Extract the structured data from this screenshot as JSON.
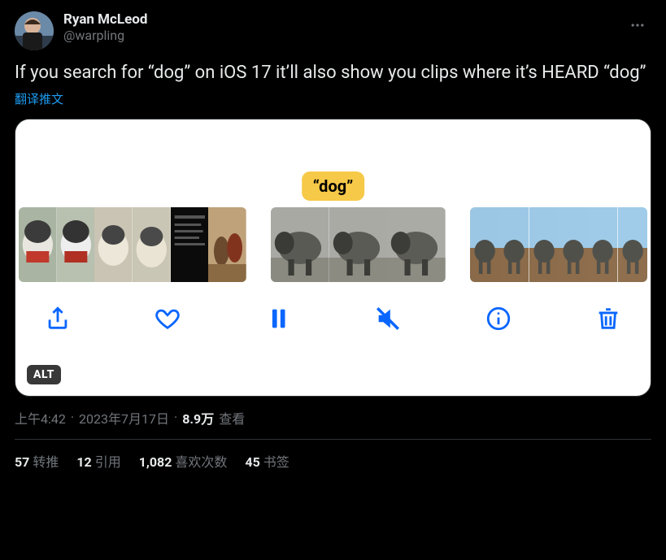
{
  "author": {
    "display_name": "Ryan McLeod",
    "handle": "@warpling"
  },
  "tweet_text": "If you search for “dog” on iOS 17 it’ll also show you clips where it’s HEARD “dog”",
  "translate_label": "翻译推文",
  "media": {
    "highlight_label": "“dog”",
    "alt_badge": "ALT"
  },
  "meta": {
    "time": "上午4:42",
    "date": "2023年7月17日",
    "views_count": "8.9万",
    "views_label": "查看"
  },
  "engagement": {
    "retweets": {
      "count": "57",
      "label": "转推"
    },
    "quotes": {
      "count": "12",
      "label": "引用"
    },
    "likes": {
      "count": "1,082",
      "label": "喜欢次数"
    },
    "bookmarks": {
      "count": "45",
      "label": "书签"
    }
  }
}
